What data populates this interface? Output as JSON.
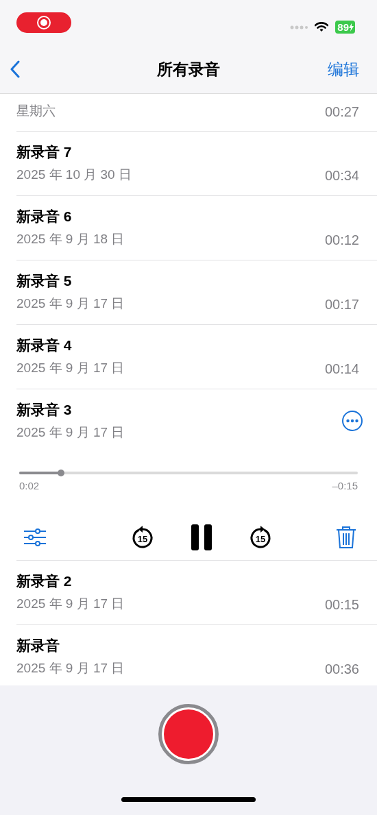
{
  "status_bar": {
    "battery": "89"
  },
  "nav": {
    "title": "所有录音",
    "edit": "编辑"
  },
  "recordings": [
    {
      "date": "星期六",
      "duration": "00:27",
      "expanded": false
    },
    {
      "title": "新录音 7",
      "date": "2025 年 10 月 30 日",
      "duration": "00:34",
      "expanded": false
    },
    {
      "title": "新录音 6",
      "date": "2025 年 9 月 18 日",
      "duration": "00:12",
      "expanded": false
    },
    {
      "title": "新录音 5",
      "date": "2025 年 9 月 17 日",
      "duration": "00:17",
      "expanded": false
    },
    {
      "title": "新录音 4",
      "date": "2025 年 9 月 17 日",
      "duration": "00:14",
      "expanded": false
    },
    {
      "title": "新录音 3",
      "date": "2025 年 9 月 17 日",
      "expanded": true,
      "player": {
        "level": 0.124,
        "elapsed": "0:02",
        "remaining": "–0:15",
        "rewind": "15",
        "forward": "15"
      }
    },
    {
      "title": "新录音 2",
      "date": "2025 年 9 月 17 日",
      "duration": "00:15",
      "expanded": false
    },
    {
      "title": "新录音",
      "date": "2025 年 9 月 17 日",
      "duration": "00:36",
      "expanded": false
    }
  ]
}
